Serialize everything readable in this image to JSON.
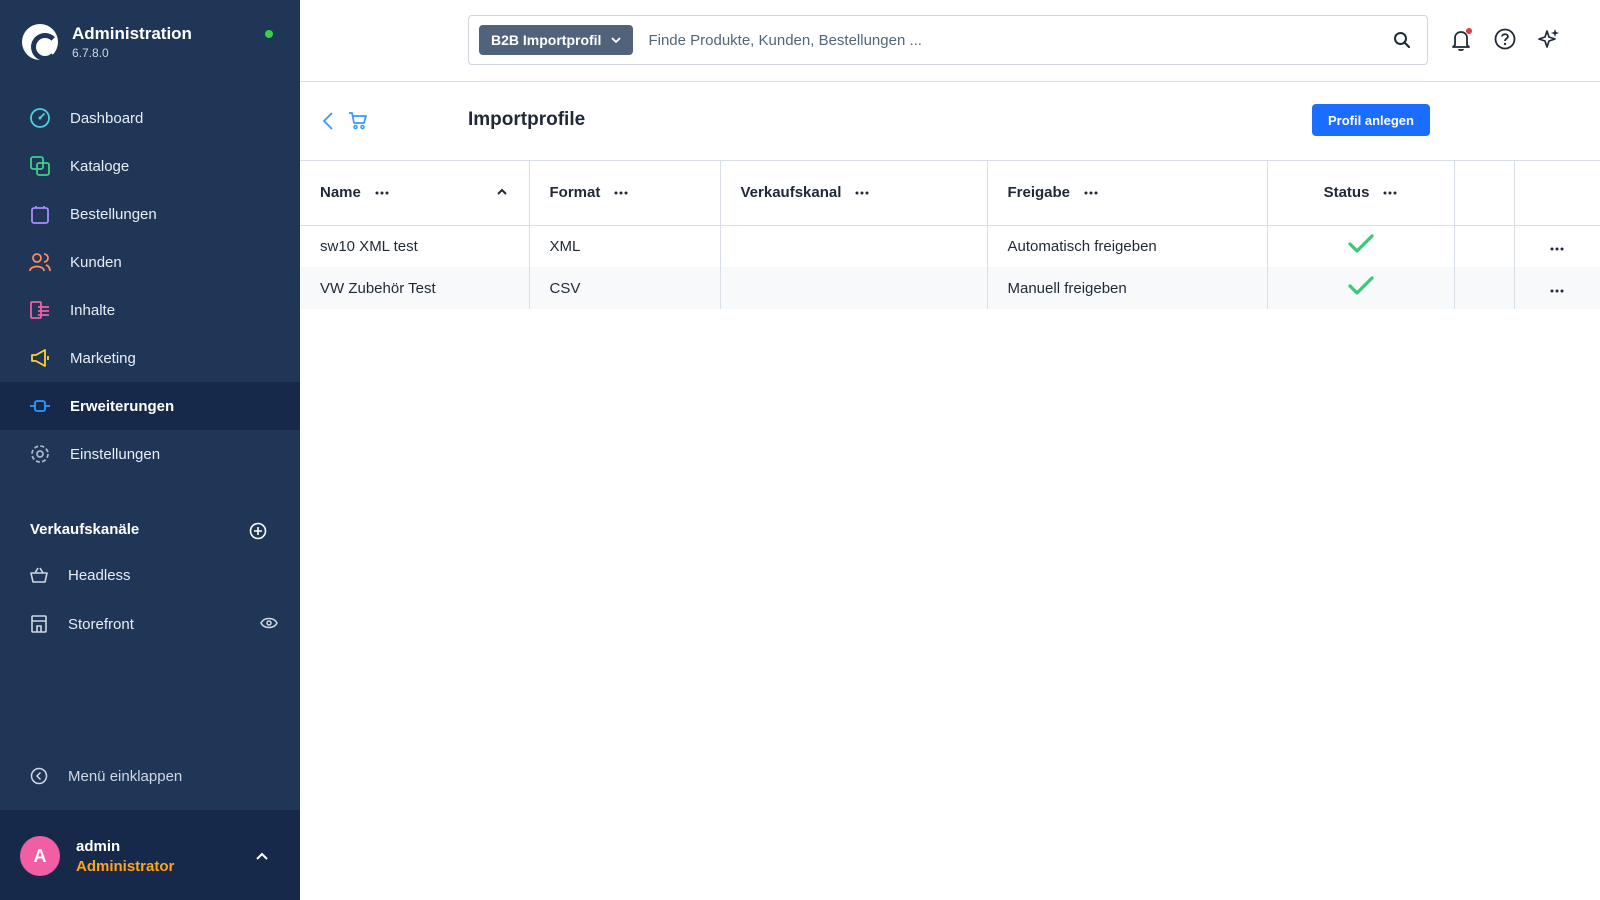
{
  "app": {
    "title": "Administration",
    "version": "6.7.8.0"
  },
  "sidebar": {
    "items": [
      {
        "label": "Dashboard",
        "icon": "dashboard-icon"
      },
      {
        "label": "Kataloge",
        "icon": "catalog-icon"
      },
      {
        "label": "Bestellungen",
        "icon": "orders-icon"
      },
      {
        "label": "Kunden",
        "icon": "customers-icon"
      },
      {
        "label": "Inhalte",
        "icon": "content-icon"
      },
      {
        "label": "Marketing",
        "icon": "marketing-icon"
      },
      {
        "label": "Erweiterungen",
        "icon": "plugin-icon",
        "active": true
      },
      {
        "label": "Einstellungen",
        "icon": "settings-icon"
      }
    ],
    "sales_channels_title": "Verkaufskanäle",
    "sales_channels": [
      {
        "label": "Headless",
        "icon": "basket-icon"
      },
      {
        "label": "Storefront",
        "icon": "storefront-icon"
      }
    ],
    "collapse_label": "Menü einklappen",
    "user": {
      "initial": "A",
      "name": "admin",
      "role": "Administrator"
    }
  },
  "search": {
    "type_label": "B2B Importprofil",
    "placeholder": "Finde Produkte, Kunden, Bestellungen ..."
  },
  "page": {
    "title": "Importprofile",
    "create_button": "Profil anlegen"
  },
  "table": {
    "columns": [
      "Name",
      "Format",
      "Verkaufskanal",
      "Freigabe",
      "Status"
    ],
    "rows": [
      {
        "name": "sw10 XML test",
        "format": "XML",
        "sales_channel": "",
        "release": "Automatisch freigeben",
        "status": true
      },
      {
        "name": "VW Zubehör Test",
        "format": "CSV",
        "sales_channel": "",
        "release": "Manuell freigeben",
        "status": true
      }
    ]
  },
  "colors": {
    "sidebar_bg": "#1f3656",
    "sidebar_active": "#16294a",
    "primary": "#1a6dff",
    "success": "#37c978",
    "accent_orange": "#ffa31a",
    "avatar_pink": "#f25ea4"
  }
}
